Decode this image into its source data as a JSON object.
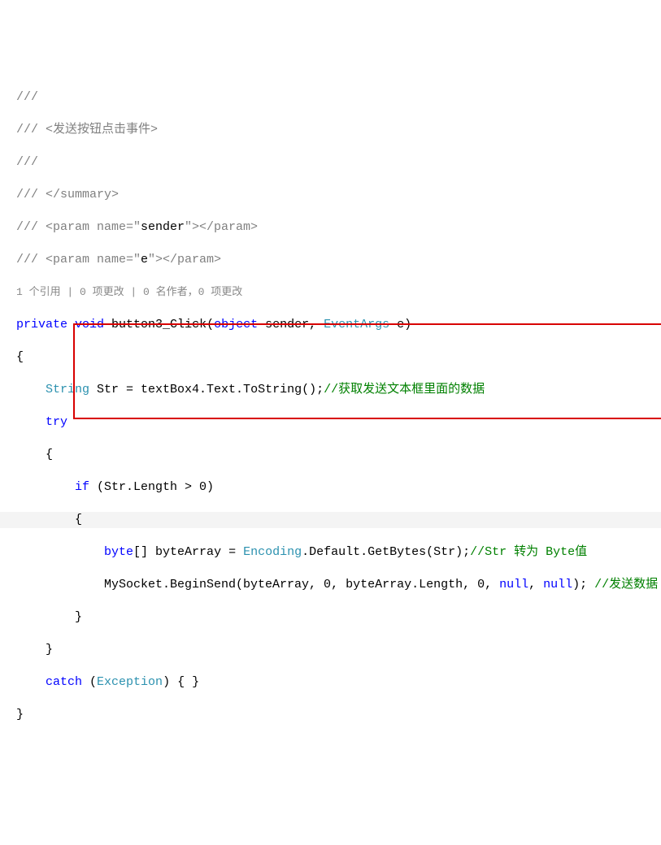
{
  "code": {
    "l1": "///",
    "l2a": "/// <发送按钮点击事件>",
    "l3": "///",
    "l4": "/// </summary>",
    "l5a": "/// <param name=\"",
    "l5b": "sender",
    "l5c": "\"></param>",
    "l6a": "/// <param name=\"",
    "l6b": "e",
    "l6c": "\"></param>",
    "codelens": "1 个引用 | 0 项更改 | 0 名作者，0 项更改",
    "l7_private": "private",
    "l7_void": "void",
    "l7_name": " button3_Click(",
    "l7_object": "object",
    "l7_sender": " sender, ",
    "l7_eventargs": "EventArgs",
    "l7_e": " e)",
    "l8_brace": "{",
    "l9_string": "String",
    "l9_rest": " Str = textBox4.Text.ToString();",
    "l9_comment": "//获取发送文本框里面的数据",
    "l10_try": "try",
    "l11_brace": "    {",
    "l12_if": "if",
    "l12_cond": " (Str.Length > 0)",
    "l13_brace": "        {",
    "l14_byte": "byte",
    "l14_arr": "[] byteArray = ",
    "l14_enc": "Encoding",
    "l14_rest": ".Default.GetBytes(Str);",
    "l14_comment": "//Str 转为 Byte值",
    "l15_a": "            MySocket.BeginSend(byteArray, 0, byteArray.Length, 0, ",
    "l15_null1": "null",
    "l15_comma": ", ",
    "l15_null2": "null",
    "l15_paren": "); ",
    "l15_comment": "//发送数据",
    "l16_brace": "        }",
    "l17_brace": "    }",
    "l18_catch": "catch",
    "l18_paren": " (",
    "l18_exc": "Exception",
    "l18_rest": ") { }",
    "l19_brace": "}"
  }
}
